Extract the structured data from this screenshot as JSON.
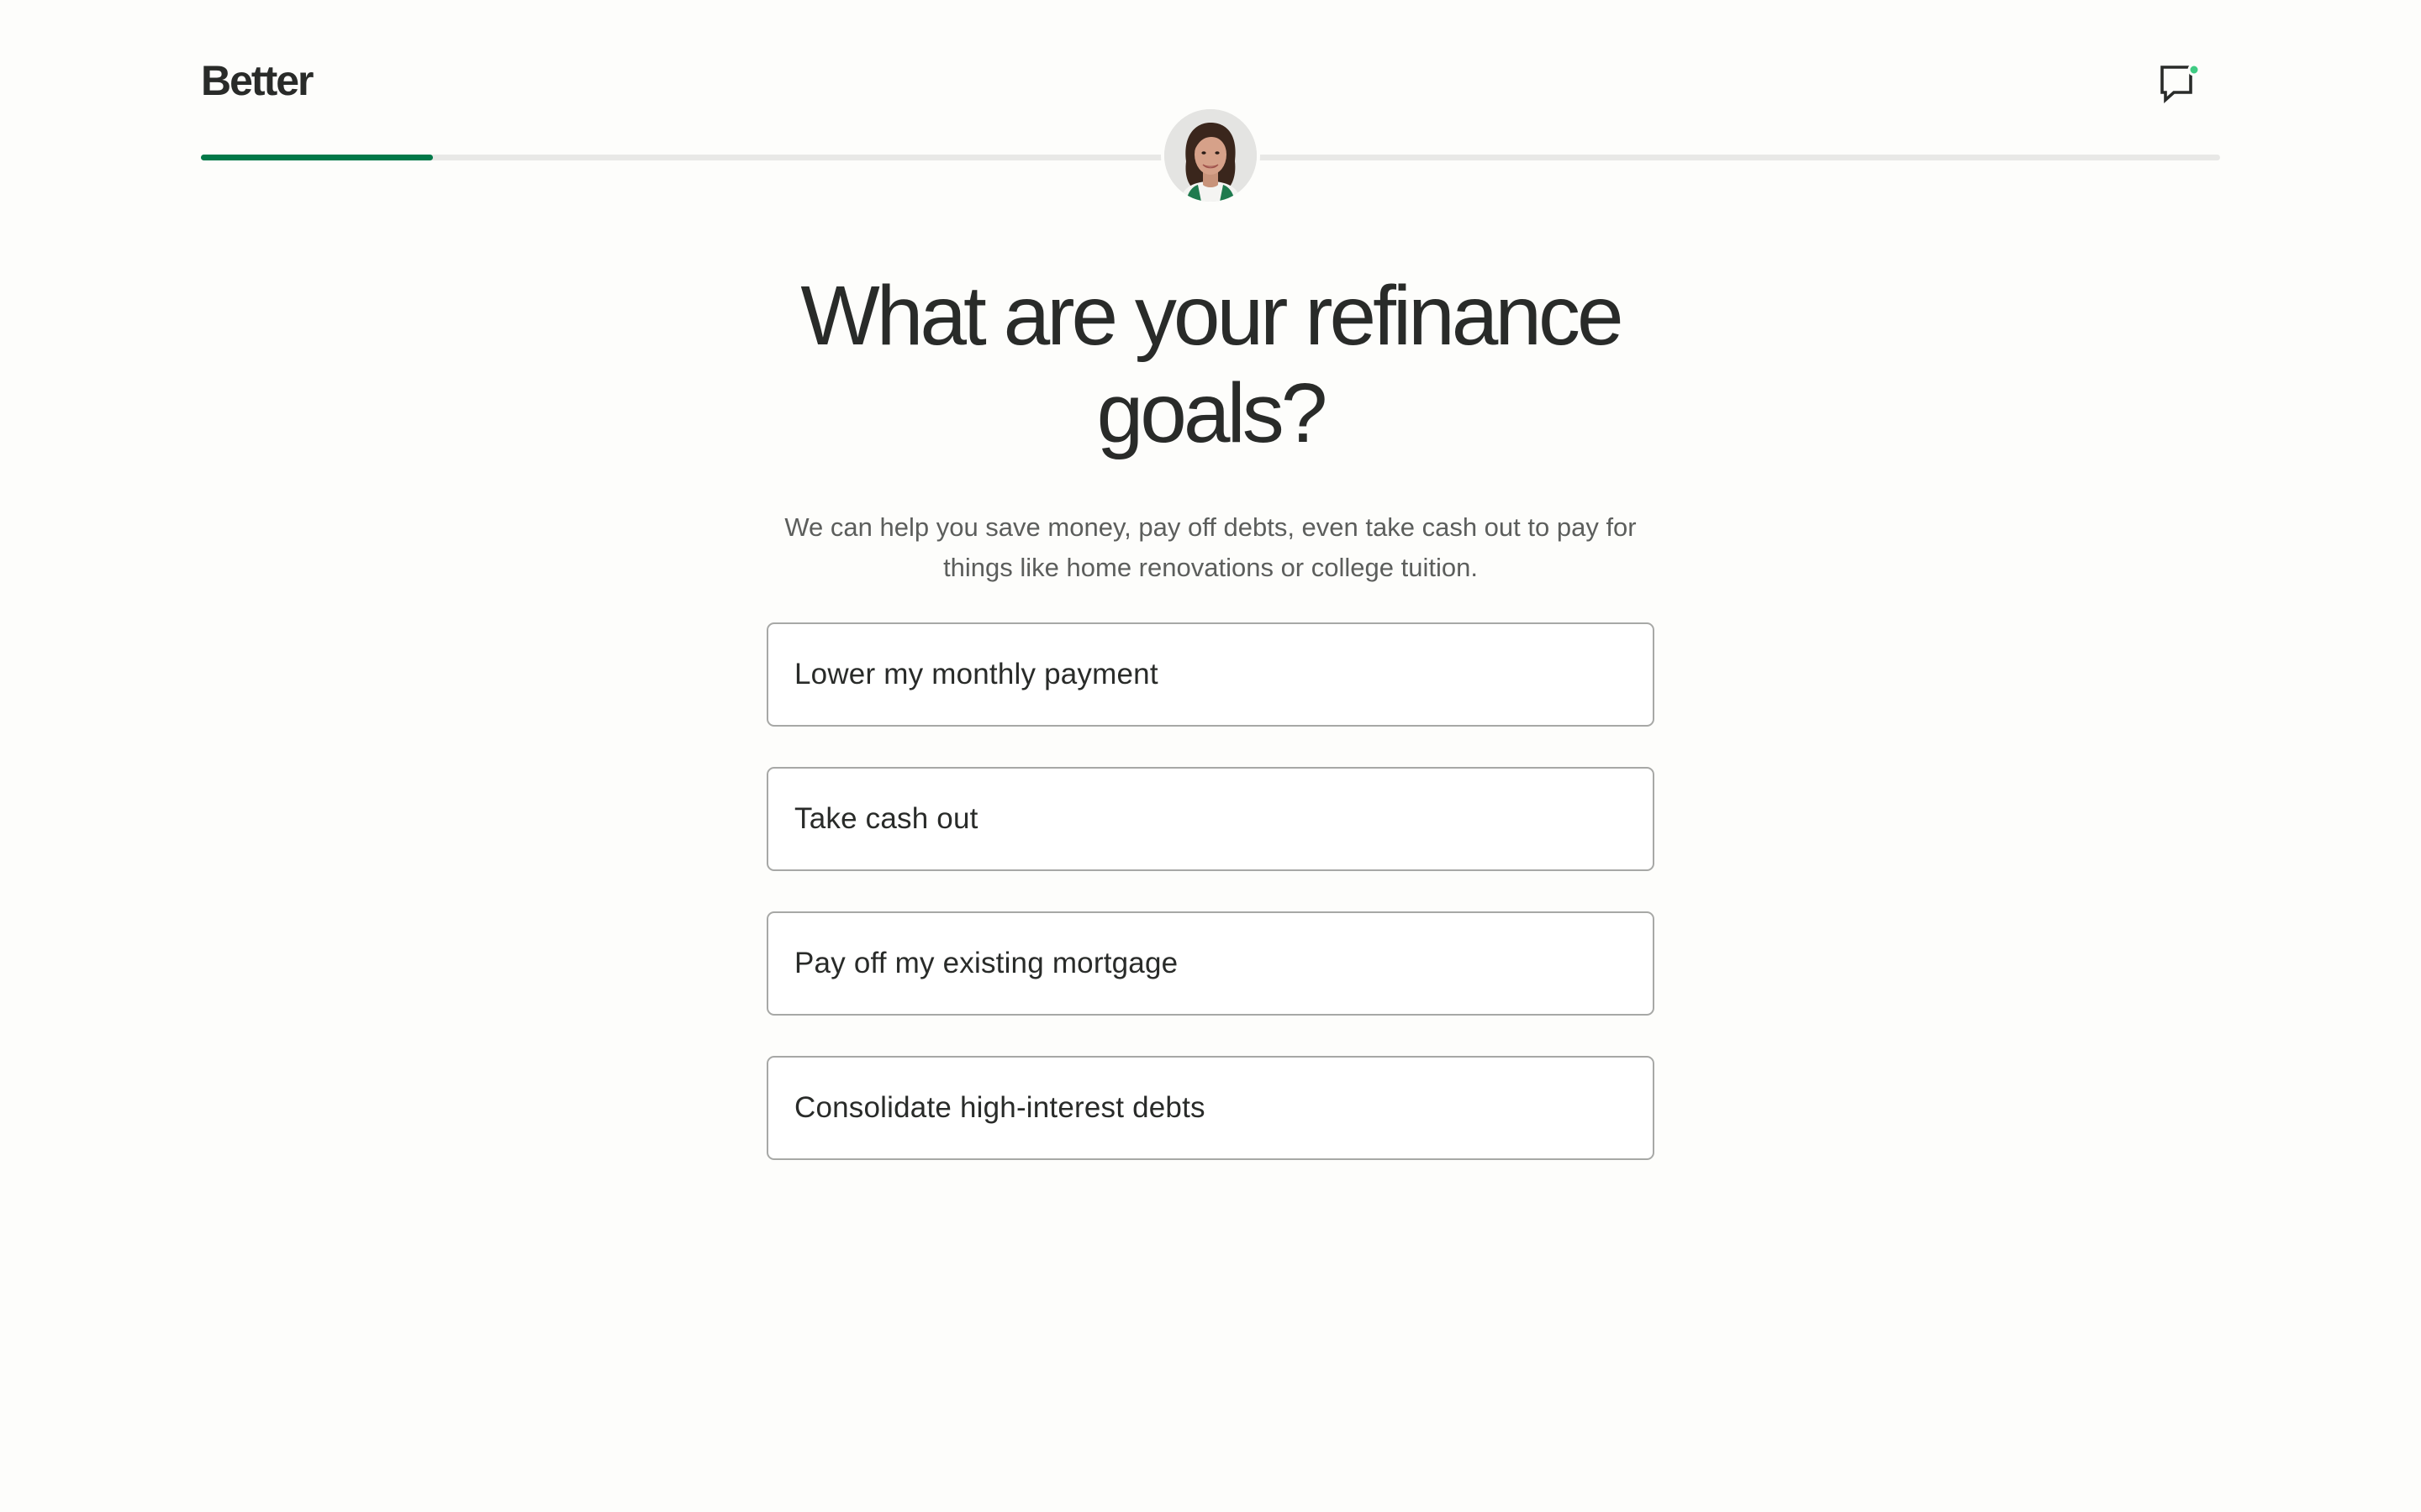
{
  "header": {
    "logo_text": "Better",
    "chat_icon": "chat-bubble-icon",
    "chat_notification_color": "#3FCB83"
  },
  "progress": {
    "fraction": 0.115,
    "fill_color": "#017848",
    "track_color": "#E8E8E6"
  },
  "advisor": {
    "icon": "advisor-avatar-icon"
  },
  "main": {
    "title": "What are your refinance goals?",
    "subtitle": "We can help you save money, pay off debts, even take cash out to pay for things like home renovations or college tuition.",
    "options": [
      {
        "label": "Lower my monthly payment"
      },
      {
        "label": "Take cash out"
      },
      {
        "label": "Pay off my existing mortgage"
      },
      {
        "label": "Consolidate high-interest debts"
      }
    ]
  }
}
